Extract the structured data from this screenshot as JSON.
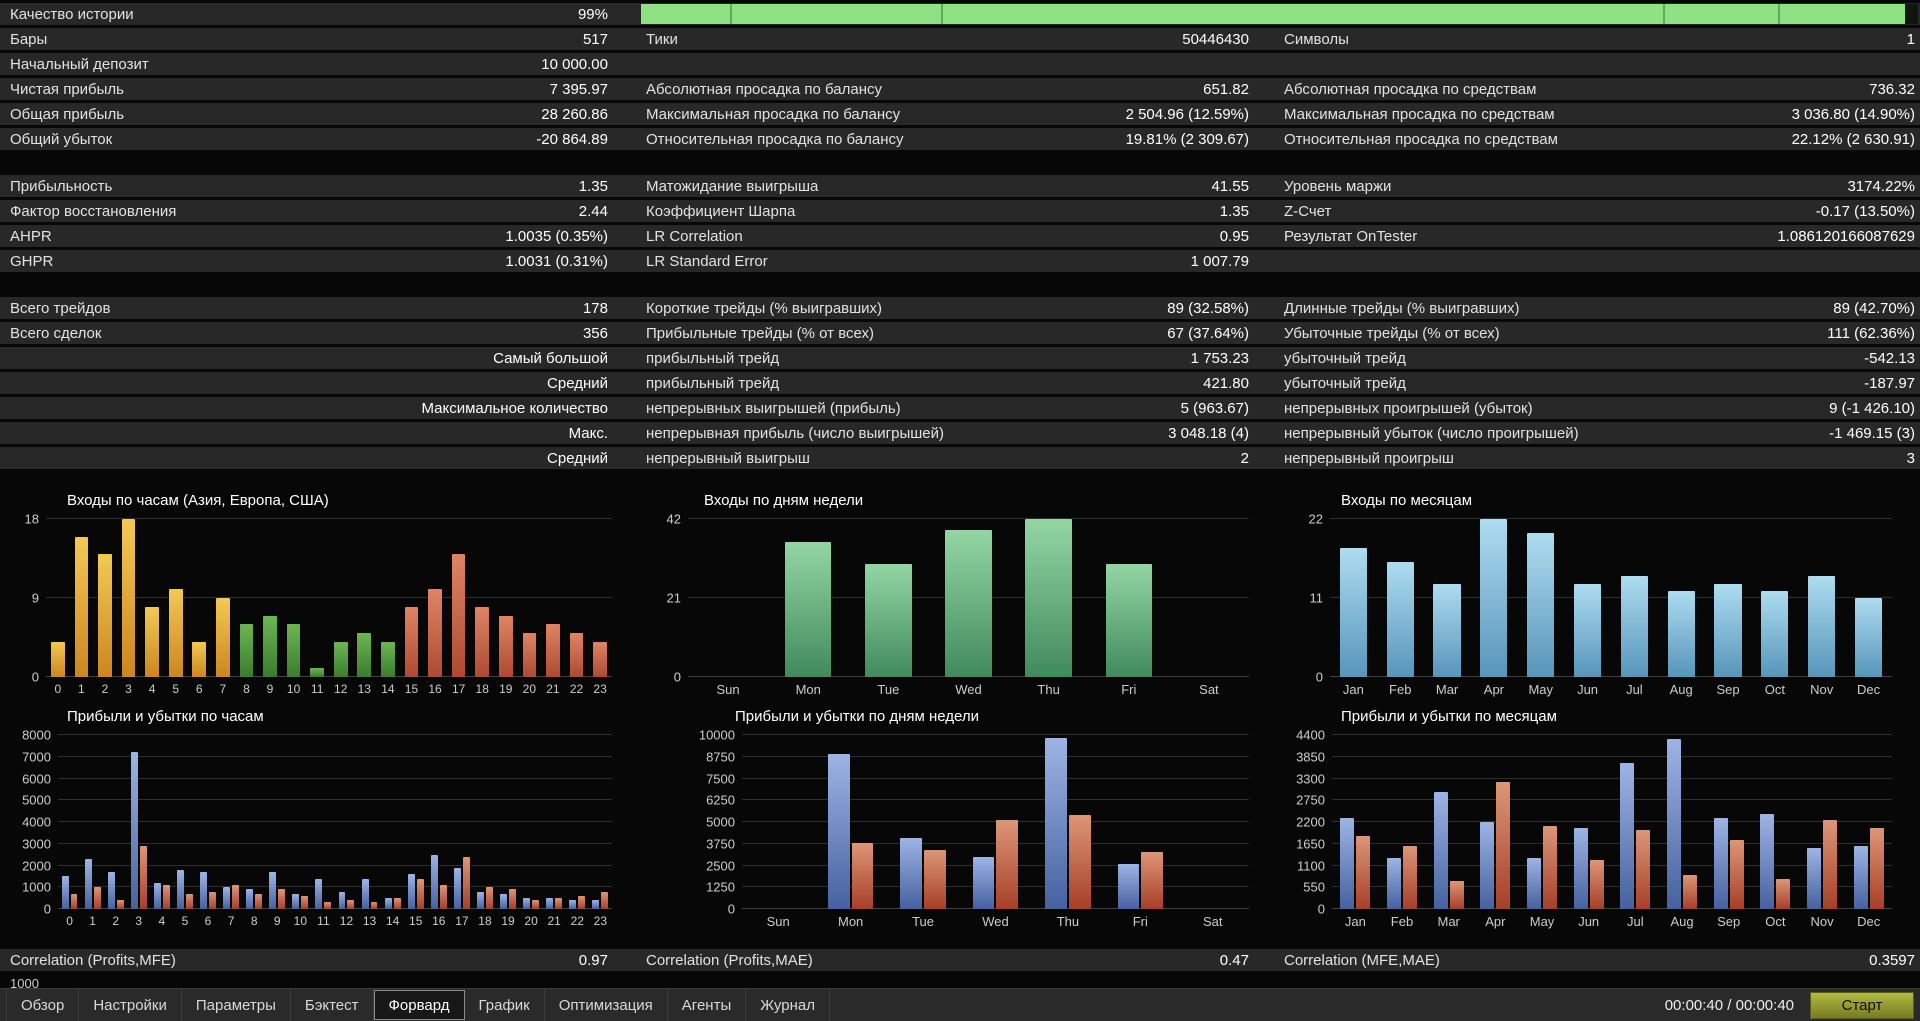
{
  "stats": {
    "sections": [
      [
        {
          "cells": [
            "Качество истории",
            "99%",
            "",
            "",
            "",
            ""
          ],
          "progress": 99
        },
        {
          "cells": [
            "Бары",
            "517",
            "Тики",
            "50446430",
            "Символы",
            "1"
          ]
        },
        {
          "cells": [
            "Начальный депозит",
            "10 000.00",
            "",
            "",
            "",
            ""
          ]
        },
        {
          "cells": [
            "Чистая прибыль",
            "7 395.97",
            "Абсолютная просадка по балансу",
            "651.82",
            "Абсолютная просадка по средствам",
            "736.32"
          ]
        },
        {
          "cells": [
            "Общая прибыль",
            "28 260.86",
            "Максимальная просадка по балансу",
            "2 504.96 (12.59%)",
            "Максимальная просадка по средствам",
            "3 036.80 (14.90%)"
          ]
        },
        {
          "cells": [
            "Общий убыток",
            "-20 864.89",
            "Относительная просадка по балансу",
            "19.81% (2 309.67)",
            "Относительная просадка по средствам",
            "22.12% (2 630.91)"
          ]
        }
      ],
      [
        {
          "cells": [
            "Прибыльность",
            "1.35",
            "Матожидание выигрыша",
            "41.55",
            "Уровень маржи",
            "3174.22%"
          ]
        },
        {
          "cells": [
            "Фактор восстановления",
            "2.44",
            "Коэффициент Шарпа",
            "1.35",
            "Z-Счет",
            "-0.17 (13.50%)"
          ]
        },
        {
          "cells": [
            "AHPR",
            "1.0035 (0.35%)",
            "LR Correlation",
            "0.95",
            "Результат OnTester",
            "1.086120166087629"
          ]
        },
        {
          "cells": [
            "GHPR",
            "1.0031 (0.31%)",
            "LR Standard Error",
            "1 007.79",
            "",
            ""
          ]
        }
      ],
      [
        {
          "cells": [
            "Всего трейдов",
            "178",
            "Короткие трейды (% выигравших)",
            "89 (32.58%)",
            "Длинные трейды (% выигравших)",
            "89 (42.70%)"
          ]
        },
        {
          "cells": [
            "Всего сделок",
            "356",
            "Прибыльные трейды (% от всех)",
            "67 (37.64%)",
            "Убыточные трейды (% от всех)",
            "111 (62.36%)"
          ]
        },
        {
          "cells": [
            "",
            "Самый большой",
            "прибыльный трейд",
            "1 753.23",
            "убыточный трейд",
            "-542.13"
          ]
        },
        {
          "cells": [
            "",
            "Средний",
            "прибыльный трейд",
            "421.80",
            "убыточный трейд",
            "-187.97"
          ]
        },
        {
          "cells": [
            "",
            "Максимальное количество",
            "непрерывных выигрышей (прибыль)",
            "5 (963.67)",
            "непрерывных проигрышей (убыток)",
            "9 (-1 426.10)"
          ]
        },
        {
          "cells": [
            "",
            "Макс.",
            "непрерывная прибыль (число выигрышей)",
            "3 048.18 (4)",
            "непрерывный убыток (число проигрышей)",
            "-1 469.15 (3)"
          ]
        },
        {
          "cells": [
            "",
            "Средний",
            "непрерывный выигрыш",
            "2",
            "непрерывный проигрыш",
            "3"
          ]
        }
      ]
    ]
  },
  "charts": [
    {
      "id": "entries-by-hour",
      "type": "bar",
      "title": "Входы по часам (Азия, Европа, США)",
      "ymax": 18,
      "yticks": [
        18,
        9,
        0
      ],
      "categories": [
        "0",
        "1",
        "2",
        "3",
        "4",
        "5",
        "6",
        "7",
        "8",
        "9",
        "10",
        "11",
        "12",
        "13",
        "14",
        "15",
        "16",
        "17",
        "18",
        "19",
        "20",
        "21",
        "22",
        "23"
      ],
      "values": [
        4,
        16,
        14,
        18,
        8,
        10,
        4,
        9,
        6,
        7,
        6,
        1,
        4,
        5,
        4,
        8,
        10,
        14,
        8,
        7,
        5,
        6,
        5,
        4
      ],
      "segments": [
        {
          "to": 7,
          "top": "#f3c954",
          "bottom": "#cc861e"
        },
        {
          "to": 14,
          "top": "#6db554",
          "bottom": "#3a7d2c"
        },
        {
          "to": 23,
          "top": "#df8465",
          "bottom": "#ad4a31"
        }
      ]
    },
    {
      "id": "entries-by-weekday",
      "type": "bar",
      "title": "Входы по дням недели",
      "ymax": 42,
      "yticks": [
        42,
        21,
        0
      ],
      "categories": [
        "Sun",
        "Mon",
        "Tue",
        "Wed",
        "Thu",
        "Fri",
        "Sat"
      ],
      "values": [
        0,
        36,
        30,
        39,
        42,
        30,
        0
      ],
      "segments": [
        {
          "to": 6,
          "top": "#93d6a4",
          "bottom": "#418a5c"
        }
      ]
    },
    {
      "id": "entries-by-month",
      "type": "bar",
      "title": "Входы по месяцам",
      "ymax": 22,
      "yticks": [
        22,
        11,
        0
      ],
      "categories": [
        "Jan",
        "Feb",
        "Mar",
        "Apr",
        "May",
        "Jun",
        "Jul",
        "Aug",
        "Sep",
        "Oct",
        "Nov",
        "Dec"
      ],
      "values": [
        18,
        16,
        13,
        22,
        20,
        13,
        14,
        12,
        13,
        12,
        14,
        11
      ],
      "segments": [
        {
          "to": 11,
          "top": "#aedcf0",
          "bottom": "#5795ba"
        }
      ]
    },
    {
      "id": "pnl-by-hour",
      "type": "bar",
      "title": "Прибыли и убытки по часам",
      "ymax": 8000,
      "yticks": [
        8000,
        7000,
        6000,
        5000,
        4000,
        3000,
        2000,
        1000,
        0
      ],
      "categories": [
        "0",
        "1",
        "2",
        "3",
        "4",
        "5",
        "6",
        "7",
        "8",
        "9",
        "10",
        "11",
        "12",
        "13",
        "14",
        "15",
        "16",
        "17",
        "18",
        "19",
        "20",
        "21",
        "22",
        "23"
      ],
      "series": [
        {
          "name": "profit",
          "top": "#9db4e4",
          "bottom": "#46619f",
          "values": [
            1500,
            2300,
            1700,
            7200,
            1200,
            1800,
            1700,
            1000,
            900,
            1700,
            700,
            1400,
            800,
            1400,
            500,
            1600,
            2500,
            1900,
            800,
            700,
            500,
            500,
            400,
            400
          ]
        },
        {
          "name": "loss",
          "top": "#dd9678",
          "bottom": "#a63f28",
          "values": [
            700,
            1000,
            400,
            2900,
            1100,
            700,
            800,
            1100,
            700,
            900,
            600,
            300,
            400,
            300,
            500,
            1400,
            1100,
            2400,
            1000,
            900,
            400,
            500,
            600,
            800
          ]
        }
      ]
    },
    {
      "id": "pnl-by-weekday",
      "type": "bar",
      "title": "Прибыли и убытки по дням недели",
      "ymax": 10000,
      "yticks": [
        10000,
        8750,
        7500,
        6250,
        5000,
        3750,
        2500,
        1250,
        0
      ],
      "categories": [
        "Sun",
        "Mon",
        "Tue",
        "Wed",
        "Thu",
        "Fri",
        "Sat"
      ],
      "series": [
        {
          "name": "profit",
          "top": "#9db4e4",
          "bottom": "#46619f",
          "values": [
            0,
            8900,
            4100,
            3000,
            9800,
            2600,
            0
          ]
        },
        {
          "name": "loss",
          "top": "#dd9678",
          "bottom": "#a63f28",
          "values": [
            0,
            3800,
            3400,
            5100,
            5400,
            3300,
            0
          ]
        }
      ]
    },
    {
      "id": "pnl-by-month",
      "type": "bar",
      "title": "Прибыли и убытки по месяцам",
      "ymax": 4400,
      "yticks": [
        4400,
        3850,
        3300,
        2750,
        2200,
        1650,
        1100,
        550,
        0
      ],
      "categories": [
        "Jan",
        "Feb",
        "Mar",
        "Apr",
        "May",
        "Jun",
        "Jul",
        "Aug",
        "Sep",
        "Oct",
        "Nov",
        "Dec"
      ],
      "series": [
        {
          "name": "profit",
          "top": "#9db4e4",
          "bottom": "#46619f",
          "values": [
            2300,
            1300,
            2950,
            2200,
            1300,
            2050,
            3700,
            4300,
            2300,
            2400,
            1550,
            1600
          ]
        },
        {
          "name": "loss",
          "top": "#dd9678",
          "bottom": "#a63f28",
          "values": [
            1850,
            1600,
            700,
            3200,
            2100,
            1250,
            2000,
            850,
            1750,
            750,
            2250,
            2050
          ]
        }
      ]
    }
  ],
  "correlations": {
    "items": [
      {
        "label": "Correlation (Profits,MFE)",
        "value": "0.97"
      },
      {
        "label": "Correlation (Profits,MAE)",
        "value": "0.47"
      },
      {
        "label": "Correlation (MFE,MAE)",
        "value": "0.3597"
      }
    ]
  },
  "partial_axis_label": "1000",
  "tabbar": {
    "tabs": [
      {
        "id": "tab-overview",
        "label": "Обзор"
      },
      {
        "id": "tab-settings",
        "label": "Настройки"
      },
      {
        "id": "tab-inputs",
        "label": "Параметры"
      },
      {
        "id": "tab-backtest",
        "label": "Бэктест"
      },
      {
        "id": "tab-forward",
        "label": "Форвард",
        "active": true
      },
      {
        "id": "tab-graph",
        "label": "График"
      },
      {
        "id": "tab-optimization",
        "label": "Оптимизация"
      },
      {
        "id": "tab-agents",
        "label": "Агенты"
      },
      {
        "id": "tab-journal",
        "label": "Журнал"
      }
    ],
    "time": "00:00:40 / 00:00:40",
    "start_button": "Старт"
  },
  "colors": {
    "progress_green": "#8ee284",
    "row_background": "#282828",
    "start_button_olive": "#8d9430"
  }
}
